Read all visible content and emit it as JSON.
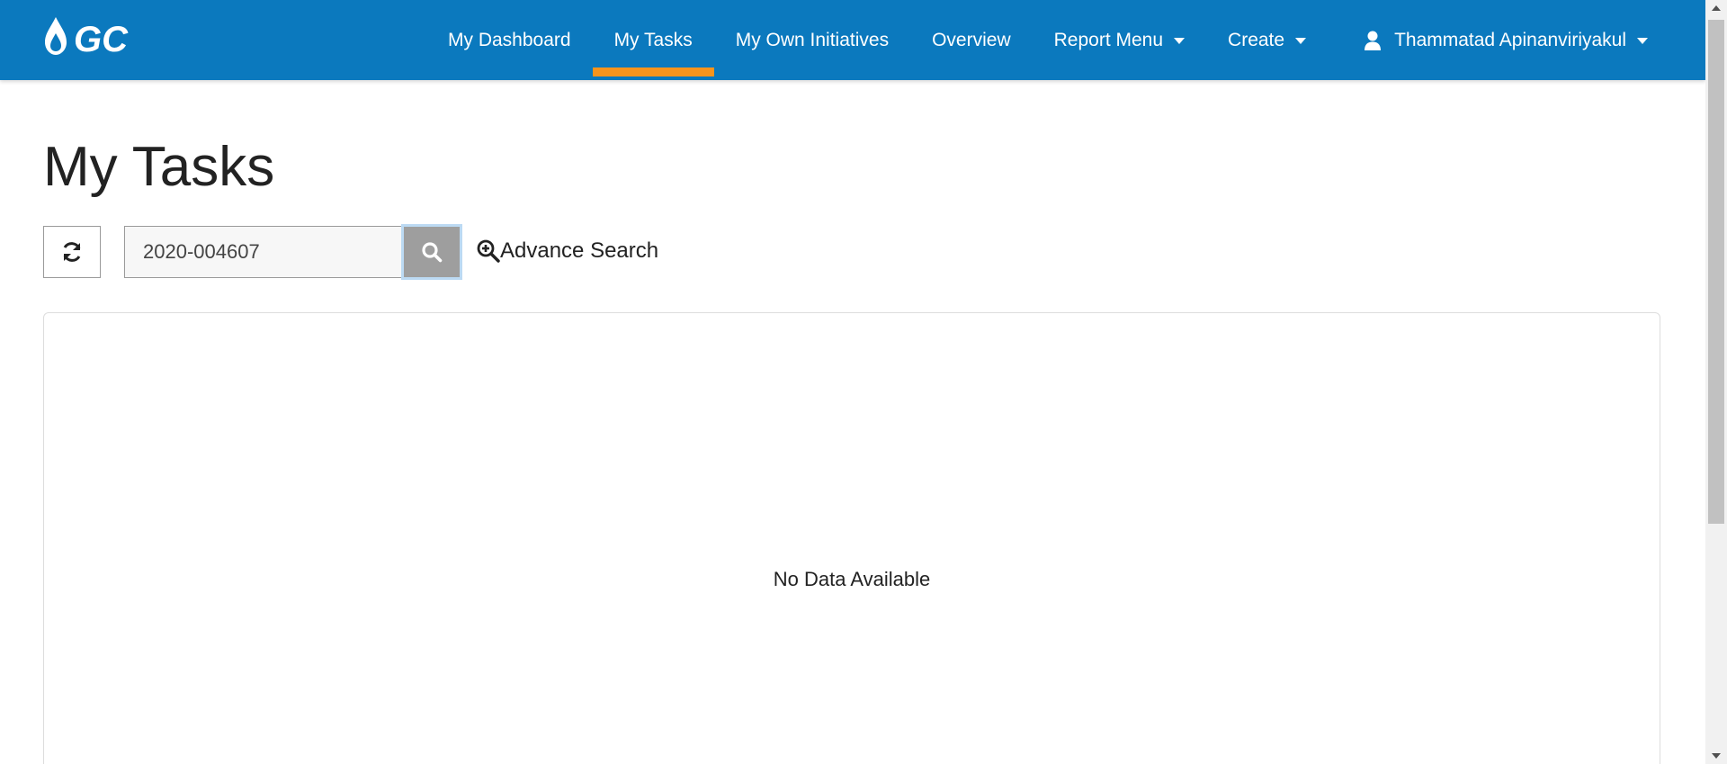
{
  "colors": {
    "navbar": "#0b79be",
    "active_underline": "#f7941d",
    "search_button": "#9e9e9e"
  },
  "header": {
    "logo_text": "GC",
    "nav": [
      {
        "label": "My Dashboard",
        "active": false
      },
      {
        "label": "My Tasks",
        "active": true
      },
      {
        "label": "My Own Initiatives",
        "active": false
      },
      {
        "label": "Overview",
        "active": false
      },
      {
        "label": "Report Menu",
        "active": false,
        "dropdown": true
      },
      {
        "label": "Create",
        "active": false,
        "dropdown": true
      }
    ],
    "user": {
      "name": "Thammatad Apinanviriyakul",
      "icon": "user-icon"
    }
  },
  "main": {
    "title": "My Tasks",
    "toolbar": {
      "refresh_icon": "refresh-icon",
      "search_value": "2020-004607",
      "search_icon": "search-icon",
      "advance_search_label": "Advance Search",
      "advance_search_icon": "zoom-in-icon"
    },
    "results": {
      "empty_message": "No Data Available"
    }
  }
}
